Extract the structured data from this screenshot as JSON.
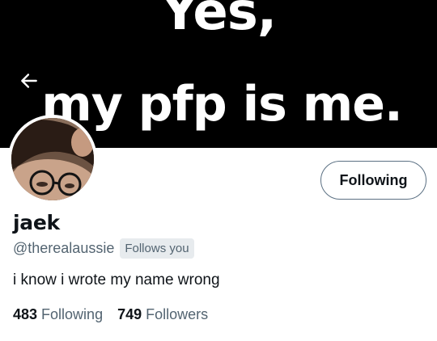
{
  "banner": {
    "line1": "Yes,",
    "line2": "my pfp is me."
  },
  "header": {
    "back_icon": "arrow-left-icon"
  },
  "profile": {
    "display_name": "jaek",
    "handle": "@therealaussie",
    "follows_you_badge": "Follows you",
    "bio": "i know i wrote my name wrong",
    "follow_button_label": "Following",
    "following_count": "483",
    "following_label": "Following",
    "followers_count": "749",
    "followers_label": "Followers"
  },
  "colors": {
    "banner_bg": "#000000",
    "text_primary": "#0f1419",
    "text_secondary": "#536471",
    "badge_bg": "#e7ebee"
  }
}
